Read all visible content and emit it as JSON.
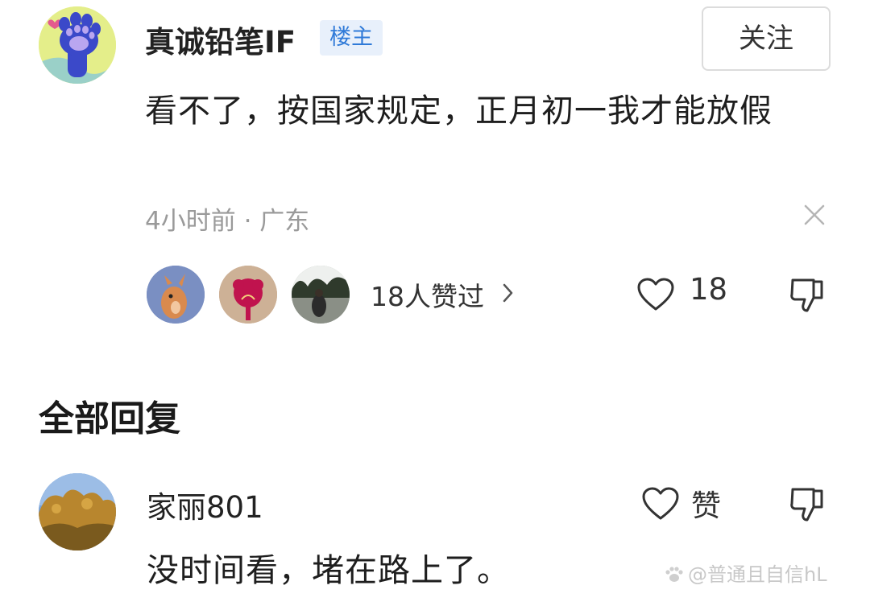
{
  "post": {
    "author": "真诚铅笔IF",
    "badge": "楼主",
    "follow_label": "关注",
    "body": "看不了，按国家规定，正月初一我才能放假",
    "meta": "4小时前 · 广东",
    "likers_text": "18人赞过",
    "like_count": "18",
    "icons": {
      "avatar": "paw-print-avatar",
      "close": "close-icon",
      "like": "heart-icon",
      "dislike": "thumbs-down-icon",
      "chevron": "chevron-right-icon"
    }
  },
  "replies": {
    "heading": "全部回复",
    "items": [
      {
        "author": "家丽801",
        "like_label": "赞",
        "body": "没时间看，堵在路上了。"
      }
    ]
  },
  "watermark": "@普通且自信hL",
  "colors": {
    "badge_bg": "#e8f0fb",
    "badge_text": "#2f7ad8",
    "meta_text": "#9a9a9a",
    "avatar_bg": "#e4ee8a"
  }
}
